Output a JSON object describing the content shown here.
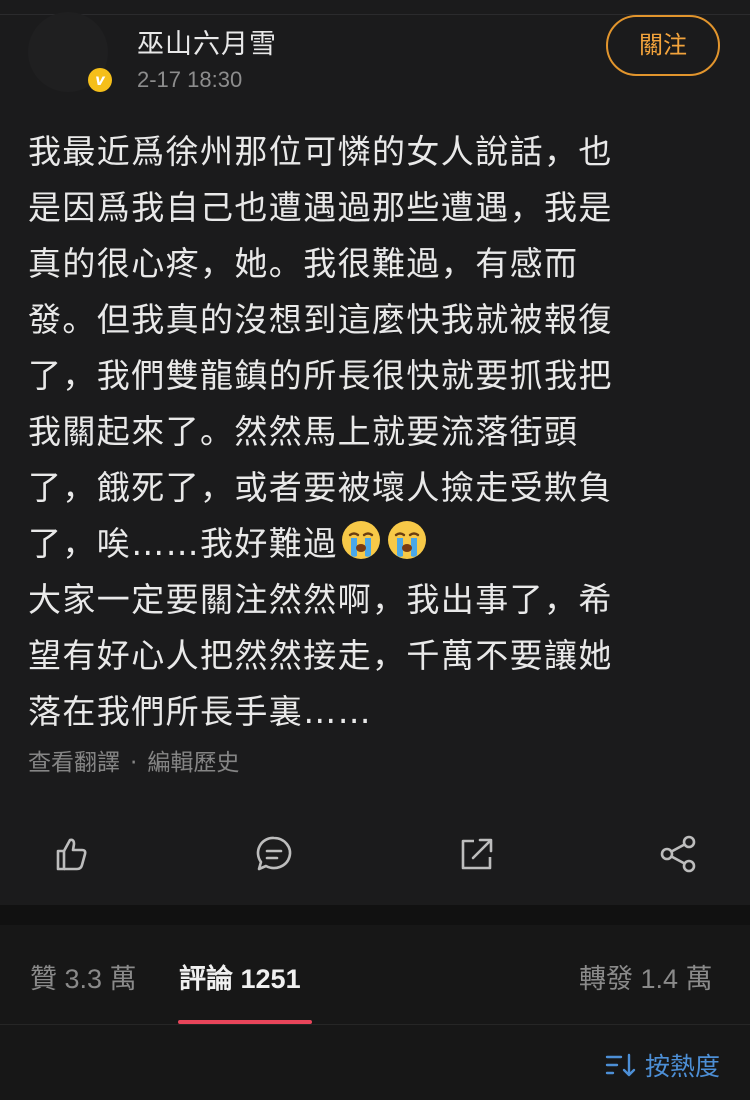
{
  "post": {
    "username": "巫山六月雪",
    "timestamp": "2-17 18:30",
    "follow_label": "關注",
    "content_lines": [
      "我最近爲徐州那位可憐的女人說話，也",
      "是因爲我自己也遭遇過那些遭遇，我是",
      "真的很心疼，她。我很難過，有感而",
      "發。但我真的沒想到這麼快我就被報復",
      "了，我們雙龍鎮的所長很快就要抓我把",
      "我關起來了。然然馬上就要流落街頭",
      "了，餓死了，或者要被壞人撿走受欺負",
      "了，唉……我好難過",
      "大家一定要關注然然啊，我出事了，希",
      "望有好心人把然然接走，千萬不要讓她",
      "落在我們所長手裏……"
    ],
    "emojis_after_line_8": [
      "loudly-crying-face",
      "loudly-crying-face"
    ],
    "meta": {
      "translate": "查看翻譯",
      "separator": "·",
      "edit_history": "編輯歷史"
    },
    "actions": [
      "like-icon",
      "comment-icon",
      "share-out-icon",
      "share-network-icon"
    ]
  },
  "tabs": {
    "likes": {
      "label": "贊",
      "count": "3.3 萬"
    },
    "comments": {
      "label": "評論",
      "count": "1251"
    },
    "reposts": {
      "label": "轉發",
      "count": "1.4 萬"
    }
  },
  "sort": {
    "label": "按熱度",
    "icon": "sort-icon"
  },
  "colors": {
    "accent_orange": "#e2952d",
    "tab_indicator": "#e8455a",
    "link_blue": "#4d8fd6",
    "verified_badge": "#f5bf1a"
  }
}
